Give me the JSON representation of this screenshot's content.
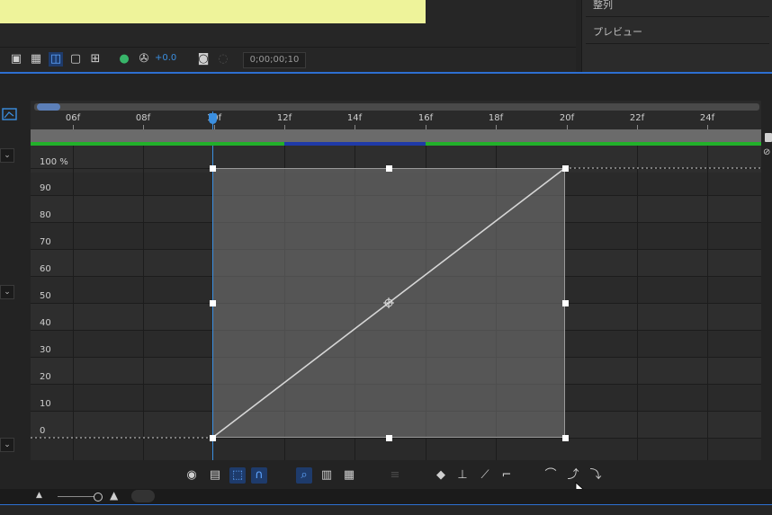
{
  "right_panel": {
    "items": [
      "整列",
      "プレビュー"
    ]
  },
  "toolbar": {
    "offset_value": "+0.0",
    "timecode": "0;00;00;10",
    "icons": [
      "motion-blur-icon",
      "draft-3d-icon",
      "graph-editor-icon",
      "frame-blend-icon",
      "shy-icon",
      "color-picker-icon",
      "swirl-icon",
      "camera-icon",
      "cache-icon"
    ]
  },
  "ruler": {
    "labels": [
      "06f",
      "08f",
      "10f",
      "12f",
      "14f",
      "16f",
      "18f",
      "20f",
      "22f",
      "24f"
    ],
    "current_frame": "10f"
  },
  "graph": {
    "y_labels": [
      "100 %",
      "90",
      "80",
      "70",
      "60",
      "50",
      "40",
      "30",
      "20",
      "10",
      "0"
    ],
    "keyframes": [
      {
        "frame": 10,
        "value": 0
      },
      {
        "frame": 20,
        "value": 100
      }
    ]
  },
  "bottom_tools": {
    "icons": [
      "eye-icon",
      "graph-type-icon",
      "show-transform-box-icon",
      "snap-icon",
      "fit-selection-icon",
      "fit-all-icon",
      "zoom-graph-icon",
      "separate-dimensions-icon",
      "keyframe-edit-icon",
      "hold-keyframe-icon",
      "linear-keyframe-icon",
      "auto-bezier-icon",
      "easy-ease-icon",
      "easy-ease-in-icon",
      "easy-ease-out-icon"
    ]
  }
}
